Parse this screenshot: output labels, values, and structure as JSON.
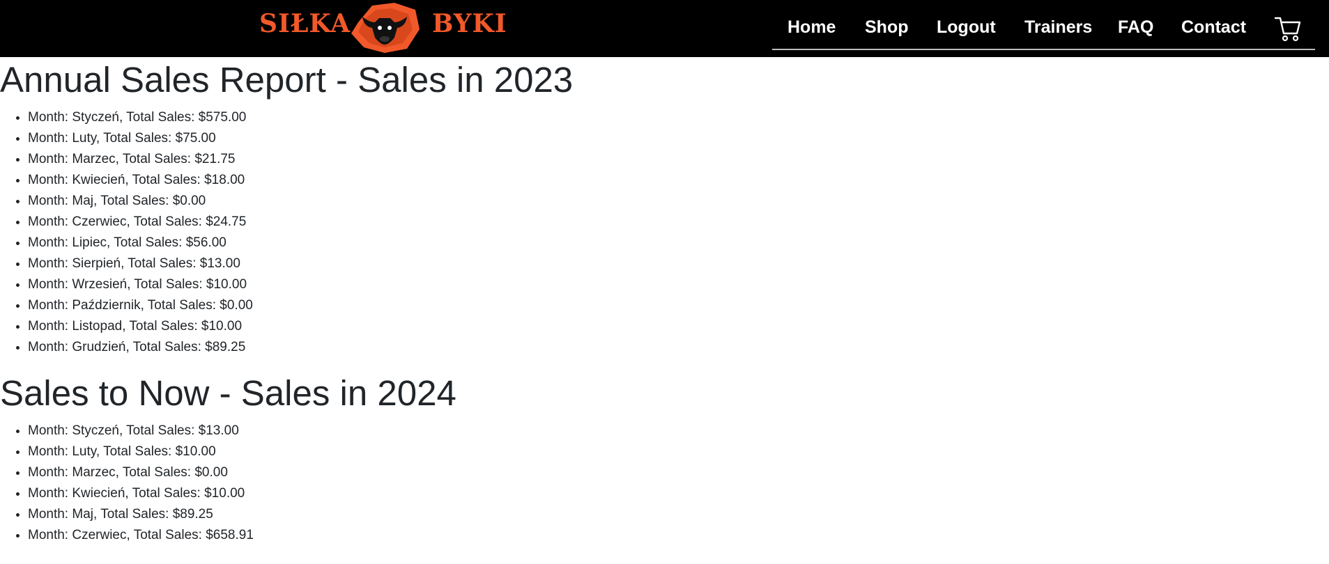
{
  "header": {
    "logo_left": "SIŁKA",
    "logo_right": "BYKI",
    "logo_emblem": "bull-head-emblem",
    "nav": [
      {
        "label": "Home"
      },
      {
        "label": "Shop"
      },
      {
        "label": "Logout"
      },
      {
        "label": "Trainers"
      },
      {
        "label": "FAQ"
      },
      {
        "label": "Contact"
      }
    ],
    "cart_icon": "cart-icon",
    "colors": {
      "background": "#000000",
      "brand": "#f2592a",
      "nav_text": "#ffffff"
    }
  },
  "sections": [
    {
      "title": "Annual Sales Report - Sales in 2023",
      "items": [
        "Month: Styczeń, Total Sales: $575.00",
        "Month: Luty, Total Sales: $75.00",
        "Month: Marzec, Total Sales: $21.75",
        "Month: Kwiecień, Total Sales: $18.00",
        "Month: Maj, Total Sales: $0.00",
        "Month: Czerwiec, Total Sales: $24.75",
        "Month: Lipiec, Total Sales: $56.00",
        "Month: Sierpień, Total Sales: $13.00",
        "Month: Wrzesień, Total Sales: $10.00",
        "Month: Październik, Total Sales: $0.00",
        "Month: Listopad, Total Sales: $10.00",
        "Month: Grudzień, Total Sales: $89.25"
      ]
    },
    {
      "title": "Sales to Now - Sales in 2024",
      "items": [
        "Month: Styczeń, Total Sales: $13.00",
        "Month: Luty, Total Sales: $10.00",
        "Month: Marzec, Total Sales: $0.00",
        "Month: Kwiecień, Total Sales: $10.00",
        "Month: Maj, Total Sales: $89.25",
        "Month: Czerwiec, Total Sales: $658.91"
      ]
    }
  ]
}
